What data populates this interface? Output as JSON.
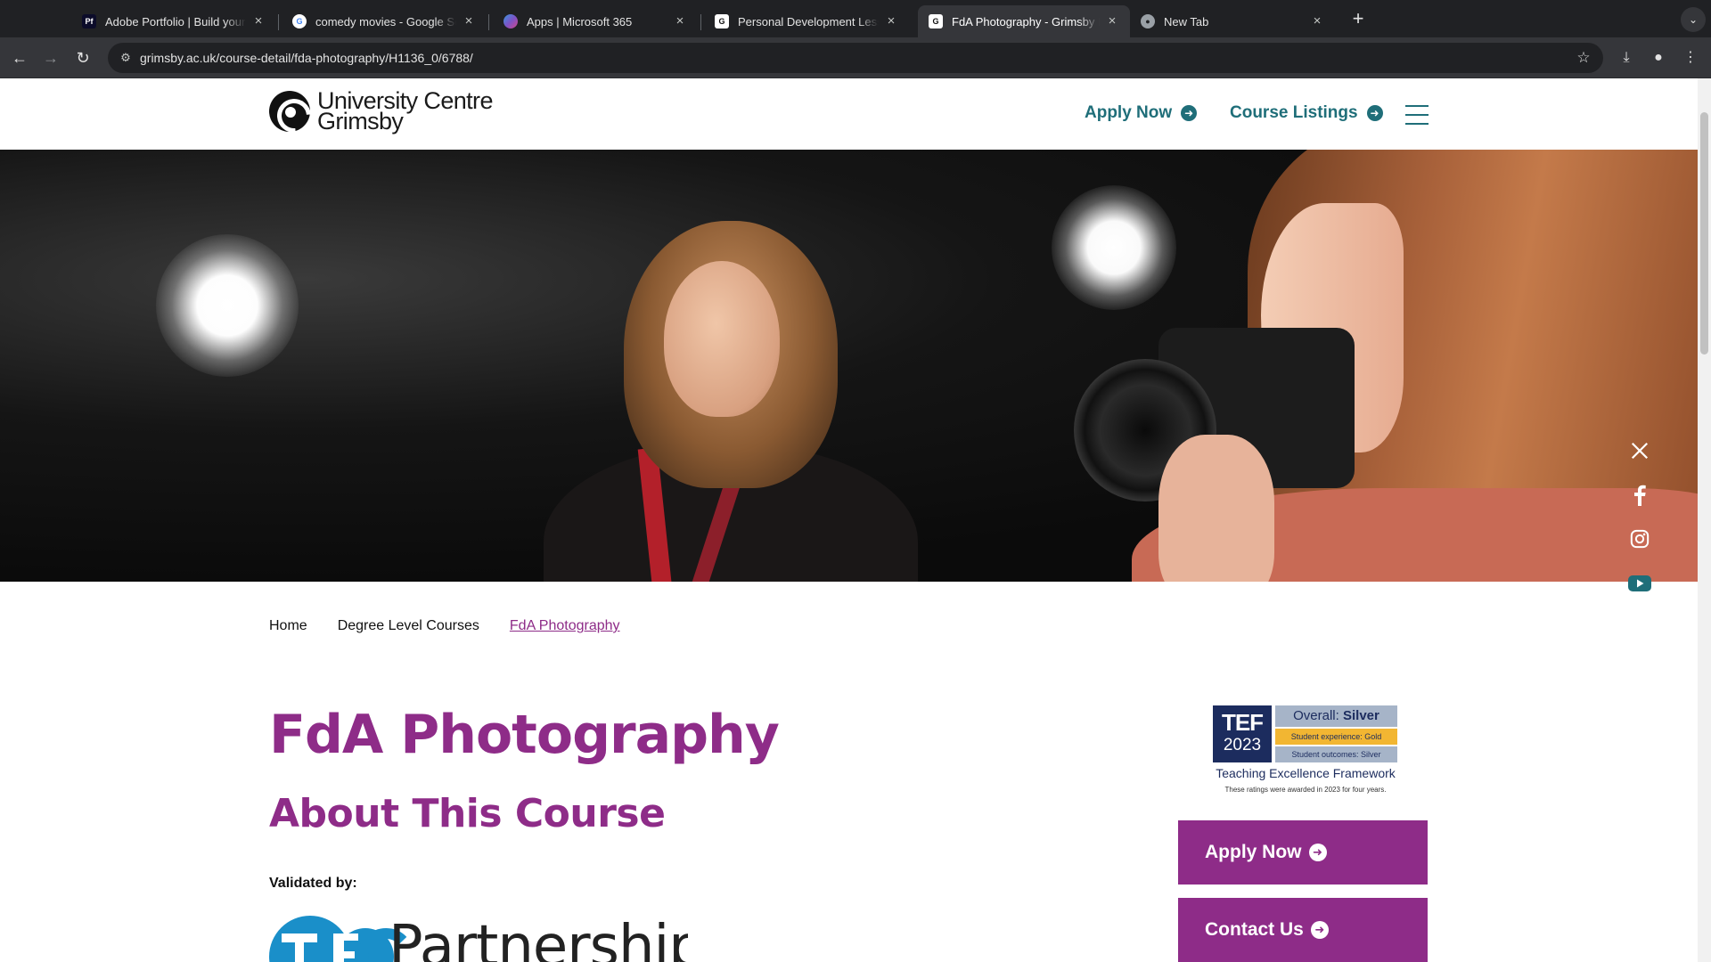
{
  "browser": {
    "tabs": [
      {
        "title": "Adobe Portfolio | Build your o",
        "favicon": "Pf",
        "favicon_color": "#0c0c2a",
        "active": false
      },
      {
        "title": "comedy movies - Google Sea",
        "favicon": "G",
        "favicon_color": "#ffffff",
        "active": false
      },
      {
        "title": "Apps | Microsoft 365",
        "favicon": "M",
        "favicon_color": "#5b5fc7",
        "active": false
      },
      {
        "title": "Personal Development Lesso",
        "favicon": "G",
        "favicon_color": "#ffffff",
        "active": false
      },
      {
        "title": "FdA Photography - Grimsby I",
        "favicon": "G",
        "favicon_color": "#ffffff",
        "active": true
      },
      {
        "title": "New Tab",
        "favicon": "chrome-icon",
        "favicon_color": "#9aa0a6",
        "active": false
      }
    ],
    "url": "grimsby.ac.uk/course-detail/fda-photography/H1136_0/6788/"
  },
  "header": {
    "logo_line1": "University Centre",
    "logo_line2": "Grimsby",
    "apply_now": "Apply Now",
    "course_listings": "Course Listings"
  },
  "social": [
    "x-icon",
    "facebook-icon",
    "instagram-icon",
    "youtube-icon"
  ],
  "breadcrumb": [
    "Home",
    "Degree Level Courses",
    "FdA Photography"
  ],
  "main": {
    "title": "FdA Photography",
    "section_title": "About This Course",
    "validated_by": "Validated by:",
    "tec_logo_text": "TEC Partnership"
  },
  "tef": {
    "badge_line1": "TEF",
    "badge_line2": "2023",
    "overall_label": "Overall:",
    "overall_value": "Silver",
    "experience": "Student experience: Gold",
    "outcomes": "Student outcomes: Silver",
    "name": "Teaching Excellence Framework",
    "note": "These ratings were awarded in 2023 for four years."
  },
  "sidebar": {
    "apply_now": "Apply Now",
    "contact_us": "Contact Us"
  },
  "colors": {
    "brand_purple": "#8e2c88",
    "brand_teal": "#1f6e79",
    "tef_navy": "#1c2c5e",
    "tef_gold": "#f2b632"
  }
}
